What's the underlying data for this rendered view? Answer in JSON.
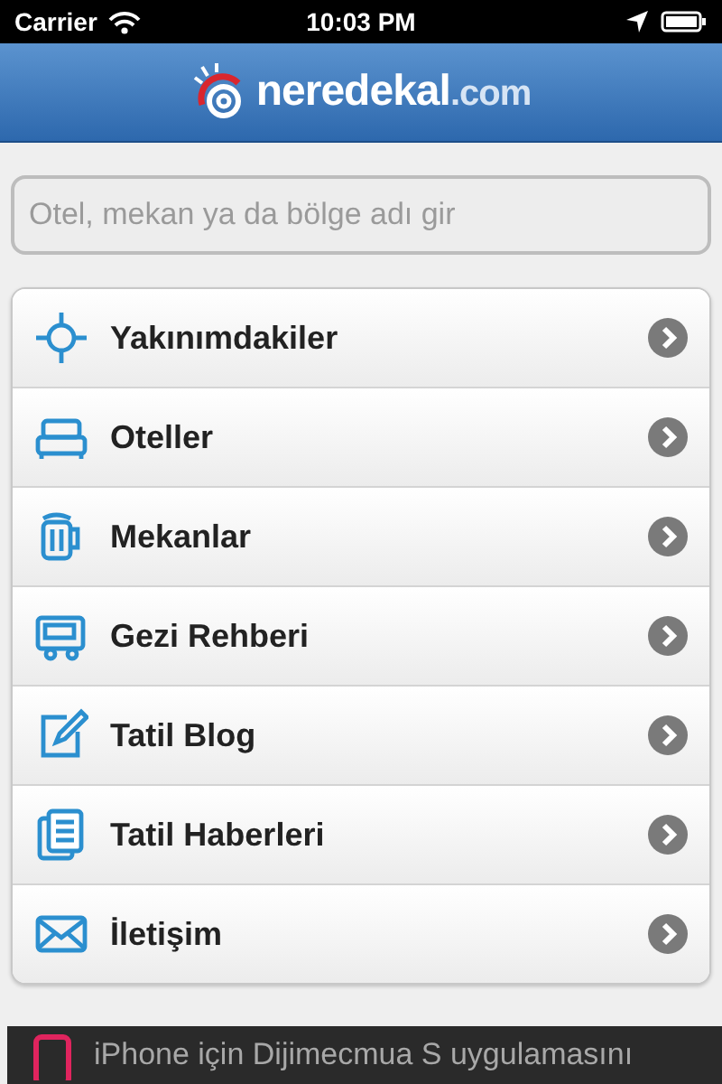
{
  "status_bar": {
    "carrier": "Carrier",
    "time": "10:03 PM"
  },
  "header": {
    "logo_main": "neredekal",
    "logo_suffix": ".com"
  },
  "search": {
    "placeholder": "Otel, mekan ya da bölge adı gir"
  },
  "menu": [
    {
      "label": "Yakınımdakiler",
      "kind": "locate"
    },
    {
      "label": "Oteller",
      "kind": "bed"
    },
    {
      "label": "Mekanlar",
      "kind": "mug"
    },
    {
      "label": "Gezi Rehberi",
      "kind": "bus"
    },
    {
      "label": "Tatil Blog",
      "kind": "edit"
    },
    {
      "label": "Tatil Haberleri",
      "kind": "news"
    },
    {
      "label": "İletişim",
      "kind": "mail"
    }
  ],
  "banner": {
    "text": "iPhone için Dijimecmua S uygulamasını"
  }
}
